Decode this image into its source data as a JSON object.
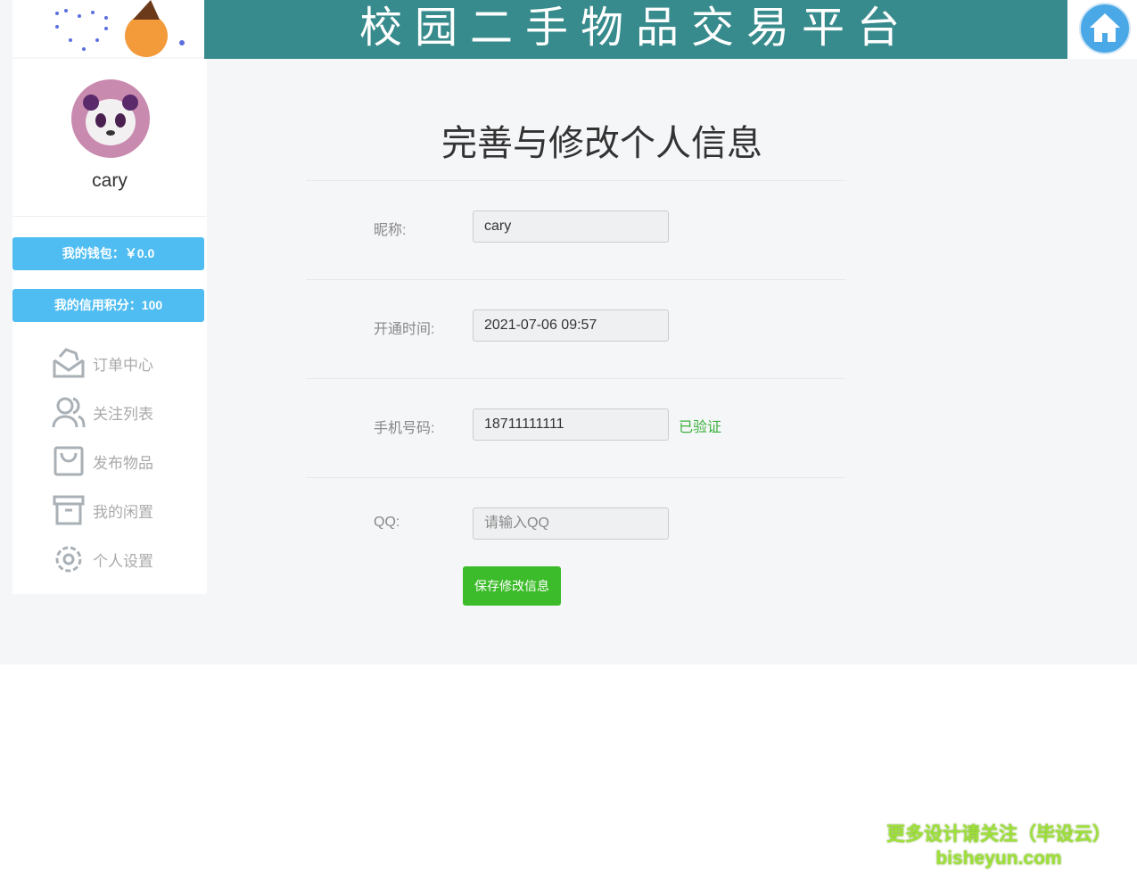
{
  "header": {
    "title": "校园二手物品交易平台",
    "home_icon": "home-icon"
  },
  "user": {
    "name": "cary",
    "wallet": "我的钱包：￥0.0",
    "credit": "我的信用积分：100"
  },
  "sidebar": {
    "items": [
      {
        "label": "订单中心",
        "icon": "envelope-icon"
      },
      {
        "label": "关注列表",
        "icon": "users-icon"
      },
      {
        "label": "发布物品",
        "icon": "bag-icon"
      },
      {
        "label": "我的闲置",
        "icon": "archive-icon"
      },
      {
        "label": "个人设置",
        "icon": "gear-icon"
      }
    ]
  },
  "form": {
    "title": "完善与修改个人信息",
    "nickname_label": "昵称:",
    "nickname": "cary",
    "opened_label": "开通时间:",
    "opened": "2021-07-06 09:57",
    "phone_label": "手机号码:",
    "phone": "18711111111",
    "verified": "已验证",
    "qq_label": "QQ:",
    "qq_placeholder": "请输入QQ",
    "save": "保存修改信息"
  },
  "watermark": {
    "line1": "更多设计请关注（毕设云）",
    "line2": "bisheyun.com"
  },
  "colors": {
    "banner": "#388b8c",
    "blue": "#4fbdf2",
    "green": "#3cbc2a"
  }
}
